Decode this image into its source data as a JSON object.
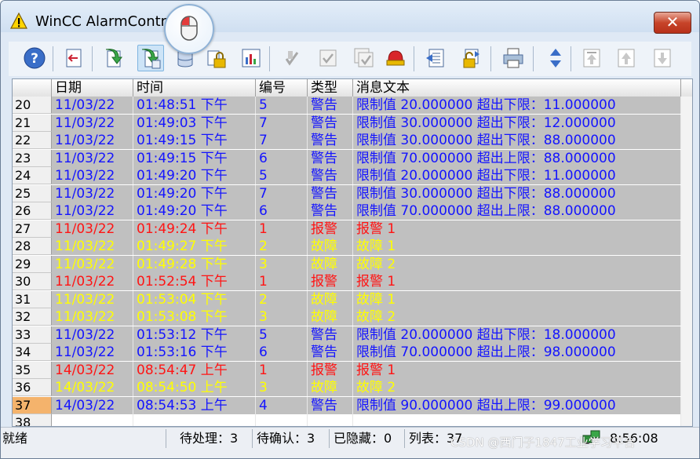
{
  "window": {
    "title": "WinCC AlarmControl",
    "close_label": "✕"
  },
  "colors": {
    "warning": "#1414ff",
    "alarm": "#ff1414",
    "fault": "#ffff00",
    "row_bg": "#c0c0c0",
    "selected_row_num": "#f4b36c"
  },
  "toolbar": {
    "buttons": [
      {
        "name": "help-icon"
      },
      {
        "name": "export-icon"
      },
      {
        "name": "load-archive-icon"
      },
      {
        "name": "load-archive-active-icon"
      },
      {
        "name": "database-icon"
      },
      {
        "name": "lock-icon"
      },
      {
        "name": "chart-icon"
      },
      {
        "name": "acknowledge-single-icon"
      },
      {
        "name": "acknowledge-group-icon"
      },
      {
        "name": "acknowledge-all-icon"
      },
      {
        "name": "horn-icon"
      },
      {
        "name": "copy-list-icon"
      },
      {
        "name": "unlock-icon"
      },
      {
        "name": "print-icon"
      },
      {
        "name": "sort-icon"
      },
      {
        "name": "first-icon"
      },
      {
        "name": "prev-icon"
      },
      {
        "name": "next-icon"
      }
    ]
  },
  "table": {
    "headers": [
      "日期",
      "时间",
      "编号",
      "类型",
      "消息文本"
    ],
    "rows": [
      {
        "n": "20",
        "date": "11/03/22",
        "time": "01:48:51 下午",
        "id": "5",
        "type": "警告",
        "text": "限制值 20.000000 超出下限：11.000000",
        "kind": "warning"
      },
      {
        "n": "21",
        "date": "11/03/22",
        "time": "01:49:03 下午",
        "id": "7",
        "type": "警告",
        "text": "限制值 30.000000 超出下限：12.000000",
        "kind": "warning"
      },
      {
        "n": "22",
        "date": "11/03/22",
        "time": "01:49:15 下午",
        "id": "7",
        "type": "警告",
        "text": "限制值 30.000000 超出下限：88.000000",
        "kind": "warning"
      },
      {
        "n": "23",
        "date": "11/03/22",
        "time": "01:49:15 下午",
        "id": "6",
        "type": "警告",
        "text": "限制值 70.000000 超出上限：88.000000",
        "kind": "warning"
      },
      {
        "n": "24",
        "date": "11/03/22",
        "time": "01:49:20 下午",
        "id": "5",
        "type": "警告",
        "text": "限制值 20.000000 超出下限：11.000000",
        "kind": "warning"
      },
      {
        "n": "25",
        "date": "11/03/22",
        "time": "01:49:20 下午",
        "id": "7",
        "type": "警告",
        "text": "限制值 30.000000 超出下限：88.000000",
        "kind": "warning"
      },
      {
        "n": "26",
        "date": "11/03/22",
        "time": "01:49:20 下午",
        "id": "6",
        "type": "警告",
        "text": "限制值 70.000000 超出上限：88.000000",
        "kind": "warning"
      },
      {
        "n": "27",
        "date": "11/03/22",
        "time": "01:49:24 下午",
        "id": "1",
        "type": "报警",
        "text": "报警 1",
        "kind": "alarm"
      },
      {
        "n": "28",
        "date": "11/03/22",
        "time": "01:49:27 下午",
        "id": "2",
        "type": "故障",
        "text": "故障 1",
        "kind": "fault"
      },
      {
        "n": "29",
        "date": "11/03/22",
        "time": "01:49:28 下午",
        "id": "3",
        "type": "故障",
        "text": "故障 2",
        "kind": "fault"
      },
      {
        "n": "30",
        "date": "11/03/22",
        "time": "01:52:54 下午",
        "id": "1",
        "type": "报警",
        "text": "报警 1",
        "kind": "alarm"
      },
      {
        "n": "31",
        "date": "11/03/22",
        "time": "01:53:04 下午",
        "id": "2",
        "type": "故障",
        "text": "故障 1",
        "kind": "fault"
      },
      {
        "n": "32",
        "date": "11/03/22",
        "time": "01:53:08 下午",
        "id": "3",
        "type": "故障",
        "text": "故障 2",
        "kind": "fault"
      },
      {
        "n": "33",
        "date": "11/03/22",
        "time": "01:53:12 下午",
        "id": "5",
        "type": "警告",
        "text": "限制值 20.000000 超出下限：18.000000",
        "kind": "warning"
      },
      {
        "n": "34",
        "date": "11/03/22",
        "time": "01:53:16 下午",
        "id": "6",
        "type": "警告",
        "text": "限制值 70.000000 超出上限：98.000000",
        "kind": "warning"
      },
      {
        "n": "35",
        "date": "14/03/22",
        "time": "08:54:47 上午",
        "id": "1",
        "type": "报警",
        "text": "报警 1",
        "kind": "alarm"
      },
      {
        "n": "36",
        "date": "14/03/22",
        "time": "08:54:50 上午",
        "id": "3",
        "type": "故障",
        "text": "故障 2",
        "kind": "fault"
      },
      {
        "n": "37",
        "date": "14/03/22",
        "time": "08:54:53 上午",
        "id": "4",
        "type": "警告",
        "text": "限制值 90.000000 超出上限：99.000000",
        "kind": "warning",
        "selected": true
      },
      {
        "n": "38",
        "date": "",
        "time": "",
        "id": "",
        "type": "",
        "text": "",
        "kind": "empty"
      }
    ]
  },
  "status": {
    "ready": "就绪",
    "pending": "待处理：3",
    "to_ack": "待确认：3",
    "hidden": "已隐藏：0",
    "list": "列表：37",
    "time": "8:56:08"
  },
  "watermark": "CSDN @西门子1847工业学习平台"
}
